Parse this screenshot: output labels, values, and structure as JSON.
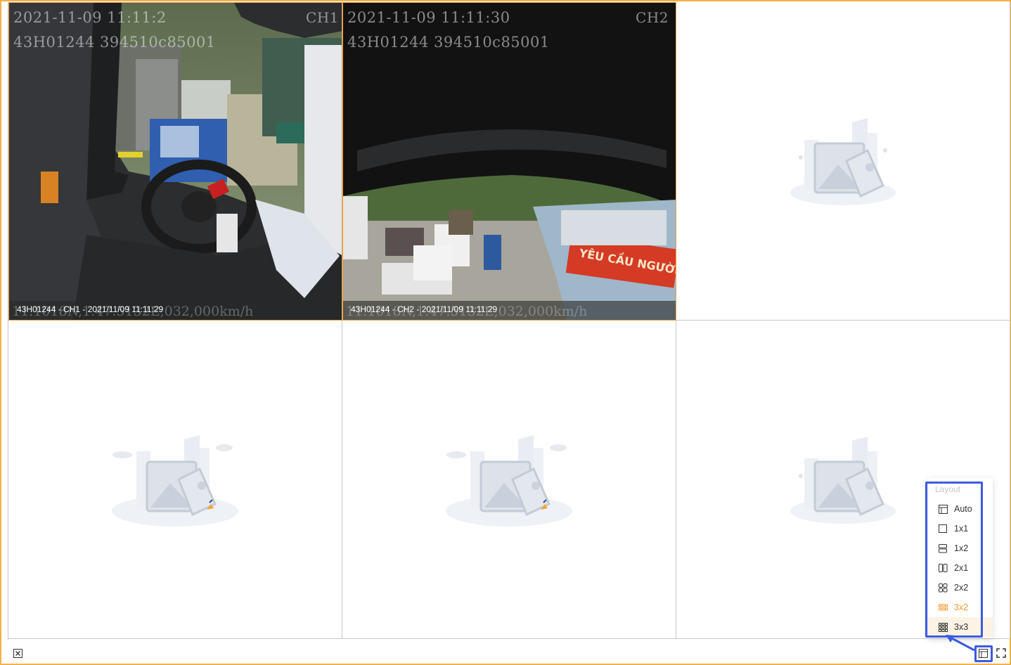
{
  "channels": [
    {
      "cell": "ch1",
      "osd_datetime": "2021-11-09 11:11:2",
      "osd_channel": "CH1",
      "osd_id": "43H01244 394510c85001",
      "caption": "43H01244 - CH1 - 2021/11/09 11:11:29",
      "osd_bottom": "11.1018N,1.47.5132E,032,000km/h"
    },
    {
      "cell": "ch2",
      "osd_datetime": "2021-11-09 11:11:30",
      "osd_channel": "CH2",
      "osd_id": "43H01244 394510c85001",
      "caption": "43H01244 - CH2 - 2021/11/09 11:11:29",
      "osd_bottom": "11.1018N,1.47.5132E,032,000km/h",
      "banner_text": "YÊU CẦU NGƯỜI DÂN CHẤP"
    }
  ],
  "empty_cells": [
    "cell-3",
    "cell-4",
    "cell-5",
    "cell-6"
  ],
  "layout_menu": {
    "title": "Layout",
    "items": [
      {
        "label": "Auto",
        "icon": "layout-auto-icon"
      },
      {
        "label": "1x1",
        "icon": "layout-1x1-icon"
      },
      {
        "label": "1x2",
        "icon": "layout-1x2-icon"
      },
      {
        "label": "2x1",
        "icon": "layout-2x1-icon"
      },
      {
        "label": "2x2",
        "icon": "layout-2x2-icon"
      },
      {
        "label": "3x2",
        "icon": "layout-3x2-icon"
      },
      {
        "label": "3x3",
        "icon": "layout-3x3-icon"
      }
    ],
    "selected": "3x2"
  },
  "toolbar": {
    "close_all_icon": "close-all-icon",
    "layout_icon": "layout-icon",
    "fullscreen_icon": "fullscreen-icon"
  },
  "colors": {
    "frame_border": "#f5b04a",
    "selected_item": "#f39a2b",
    "annotation_blue": "#3d5be0"
  }
}
